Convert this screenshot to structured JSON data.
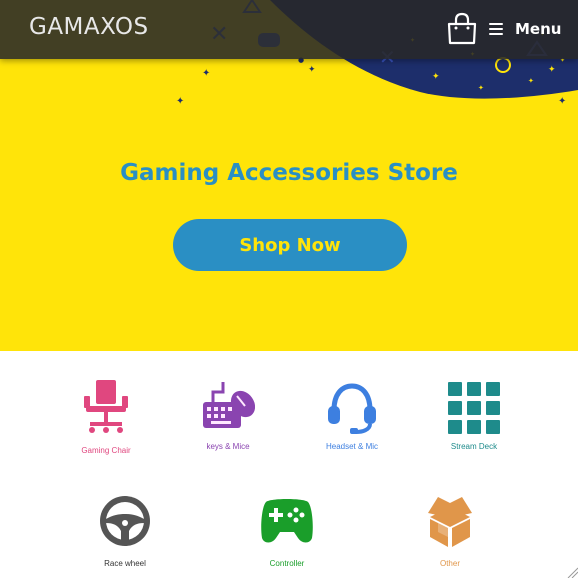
{
  "header": {
    "logo_text": "GAMAXOS",
    "menu_label": "Menu",
    "background": "#2b2b2b"
  },
  "hero": {
    "background": "#ffe409",
    "accent": "#2a8fc4",
    "night_blob": "#1d2e6b",
    "title": "Gaming Accessories Store",
    "cta_label": "Shop Now"
  },
  "categories": [
    {
      "label": "Gaming Chair",
      "icon": "chair-icon",
      "color": "#e0477f"
    },
    {
      "label": "keys & Mice",
      "icon": "keyboard-mouse-icon",
      "color": "#8a44b0"
    },
    {
      "label": "Headset & Mic",
      "icon": "headset-icon",
      "color": "#3d7fe0"
    },
    {
      "label": "Stream Deck",
      "icon": "grid-icon",
      "color": "#1e8b8b"
    },
    {
      "label": "Race wheel",
      "icon": "steering-wheel-icon",
      "color": "#555555"
    },
    {
      "label": "Controller",
      "icon": "gamepad-icon",
      "color": "#1a9e2a"
    },
    {
      "label": "Other",
      "icon": "box-icon",
      "color": "#e0964a"
    }
  ]
}
